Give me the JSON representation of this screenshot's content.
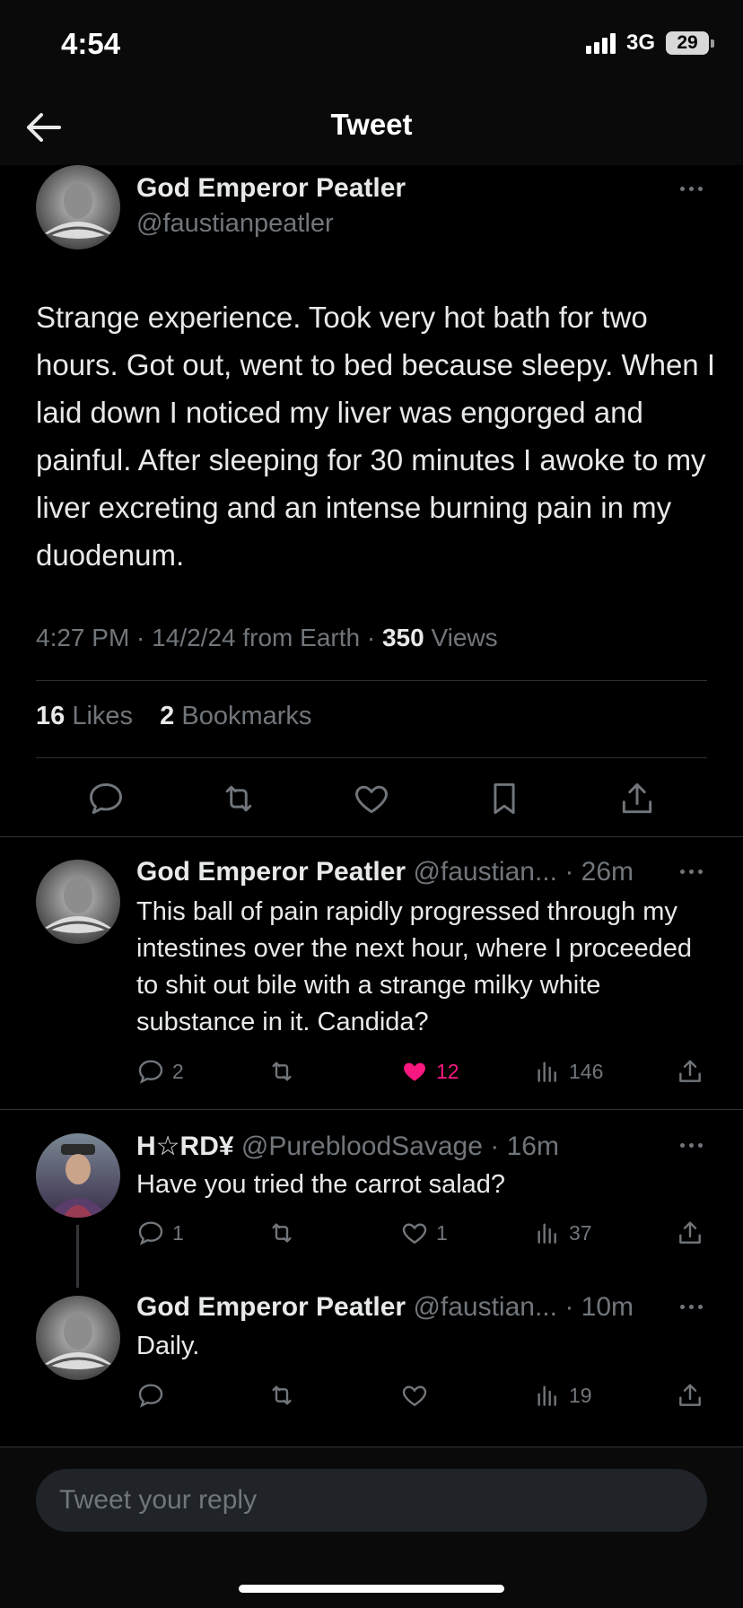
{
  "status_bar": {
    "time": "4:54",
    "network": "3G",
    "battery": "29"
  },
  "nav": {
    "title": "Tweet"
  },
  "main_tweet": {
    "name": "God Emperor Peatler",
    "handle": "@faustianpeatler",
    "text": "Strange experience. Took very hot bath for two hours. Got out, went to bed because sleepy. When I laid down I noticed my liver was engorged and painful. After sleeping for 30 minutes I awoke to my liver excreting and an intense burning pain in my duodenum.",
    "time": "4:27 PM",
    "date": "14/2/24",
    "source": "from Earth",
    "views_count": "350",
    "views_label": "Views",
    "likes_count": "16",
    "likes_label": "Likes",
    "bookmarks_count": "2",
    "bookmarks_label": "Bookmarks"
  },
  "replies": [
    {
      "name": "God Emperor Peatler",
      "handle": "@faustian...",
      "time": "26m",
      "text": "This ball of pain rapidly progressed through my intestines over the next hour, where I proceeded to shit out bile with a strange milky white substance in it. Candida?",
      "reply_count": "2",
      "retweet_count": "",
      "like_count": "12",
      "liked": true,
      "view_count": "146"
    },
    {
      "name": "H☆RD¥",
      "handle": "@PurebloodSavage",
      "time": "16m",
      "text": "Have you tried the carrot salad?",
      "reply_count": "1",
      "retweet_count": "",
      "like_count": "1",
      "liked": false,
      "view_count": "37"
    },
    {
      "name": "God Emperor Peatler",
      "handle": "@faustian...",
      "time": "10m",
      "text": "Daily.",
      "reply_count": "",
      "retweet_count": "",
      "like_count": "",
      "liked": false,
      "view_count": "19"
    }
  ],
  "reply_box": {
    "placeholder": "Tweet your reply"
  },
  "colors": {
    "background": "#000000",
    "text": "#e7e9ea",
    "muted": "#71767b",
    "like": "#f91880",
    "divider": "#2f3336"
  },
  "icons": [
    "back-arrow-icon",
    "more-icon",
    "reply-icon",
    "retweet-icon",
    "like-icon",
    "bookmark-icon",
    "share-icon",
    "views-icon"
  ]
}
